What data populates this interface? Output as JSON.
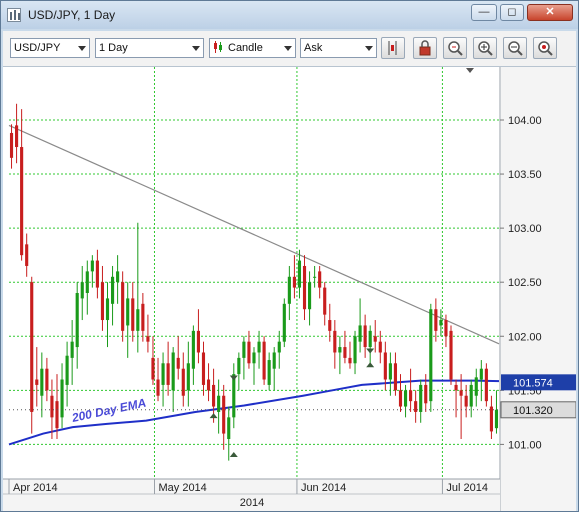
{
  "window": {
    "title": "USD/JPY,  1 Day",
    "minimize": "—",
    "restore": "◻",
    "close": "✕"
  },
  "toolbar": {
    "symbol": "USD/JPY",
    "period": "1 Day",
    "chart_type": "Candle",
    "price_side": "Ask"
  },
  "colors": {
    "up": "#1a9a1a",
    "down": "#c81e1e",
    "grid": "#30c830",
    "ema": "#1f2fc8",
    "trendline": "#8a8a8a",
    "badge": "#1e3fa8"
  },
  "chart_data": {
    "type": "candlestick",
    "symbol": "USD/JPY",
    "timeframe": "1 Day",
    "ylim": [
      100.68,
      104.49
    ],
    "y_ticks": [
      "104.00",
      "103.50",
      "103.00",
      "102.50",
      "102.00",
      "101.50",
      "101.00"
    ],
    "x_ticks": [
      "Apr 2014",
      "May 2014",
      "Jun 2014",
      "Jul 2014"
    ],
    "x_year_label": "2014",
    "current_price": "101.320",
    "ema_value": "101.574",
    "annotation": "200 Day EMA",
    "candles": [
      [
        103.88,
        103.96,
        103.55,
        103.65
      ],
      [
        103.95,
        104.15,
        103.6,
        103.75
      ],
      [
        103.75,
        104.1,
        102.7,
        102.75
      ],
      [
        102.85,
        102.95,
        102.55,
        102.65
      ],
      [
        102.5,
        102.55,
        101.1,
        101.3
      ],
      [
        101.6,
        101.9,
        101.35,
        101.55
      ],
      [
        101.45,
        101.85,
        101.25,
        101.7
      ],
      [
        101.7,
        101.8,
        101.4,
        101.5
      ],
      [
        101.45,
        101.6,
        101.05,
        101.25
      ],
      [
        101.4,
        101.65,
        101.05,
        101.15
      ],
      [
        101.25,
        101.75,
        101.15,
        101.6
      ],
      [
        101.55,
        101.95,
        101.35,
        101.82
      ],
      [
        101.8,
        102.15,
        101.55,
        101.95
      ],
      [
        101.9,
        102.5,
        101.7,
        102.4
      ],
      [
        102.35,
        102.65,
        102.15,
        102.5
      ],
      [
        102.4,
        102.7,
        102.2,
        102.6
      ],
      [
        102.6,
        102.75,
        102.45,
        102.7
      ],
      [
        102.7,
        102.8,
        102.35,
        102.45
      ],
      [
        102.5,
        102.65,
        102.05,
        102.15
      ],
      [
        102.15,
        102.5,
        101.9,
        102.35
      ],
      [
        102.3,
        102.65,
        102.1,
        102.55
      ],
      [
        102.5,
        102.75,
        102.3,
        102.6
      ],
      [
        102.5,
        102.6,
        101.95,
        102.05
      ],
      [
        102.1,
        102.5,
        101.8,
        102.35
      ],
      [
        102.35,
        102.5,
        101.95,
        102.05
      ],
      [
        102.05,
        103.05,
        101.85,
        102.25
      ],
      [
        102.3,
        102.4,
        101.95,
        102.05
      ],
      [
        102.0,
        102.2,
        101.85,
        101.95
      ],
      [
        101.8,
        102.0,
        101.55,
        101.6
      ],
      [
        101.6,
        101.8,
        101.4,
        101.45
      ],
      [
        101.55,
        101.85,
        101.35,
        101.75
      ],
      [
        101.75,
        101.95,
        101.45,
        101.55
      ],
      [
        101.5,
        101.9,
        101.3,
        101.85
      ],
      [
        101.8,
        102.0,
        101.6,
        101.7
      ],
      [
        101.7,
        101.85,
        101.35,
        101.45
      ],
      [
        101.5,
        101.95,
        101.35,
        101.75
      ],
      [
        101.7,
        102.1,
        101.55,
        102.05
      ],
      [
        102.05,
        102.25,
        101.75,
        101.85
      ],
      [
        101.85,
        101.95,
        101.45,
        101.55
      ],
      [
        101.6,
        101.75,
        101.4,
        101.5
      ],
      [
        101.55,
        101.7,
        101.2,
        101.35
      ],
      [
        101.3,
        101.6,
        101.1,
        101.45
      ],
      [
        101.45,
        101.55,
        100.95,
        101.1
      ],
      [
        101.05,
        101.35,
        100.85,
        101.25
      ],
      [
        101.25,
        101.75,
        101.15,
        101.65
      ],
      [
        101.65,
        101.85,
        101.5,
        101.8
      ],
      [
        101.8,
        102.0,
        101.6,
        101.95
      ],
      [
        101.95,
        102.05,
        101.7,
        101.75
      ],
      [
        101.75,
        101.9,
        101.55,
        101.85
      ],
      [
        101.85,
        102.05,
        101.7,
        101.95
      ],
      [
        101.95,
        102.0,
        101.55,
        101.6
      ],
      [
        101.55,
        101.85,
        101.5,
        101.78
      ],
      [
        101.7,
        101.9,
        101.5,
        101.85
      ],
      [
        101.85,
        102.05,
        101.7,
        101.95
      ],
      [
        101.95,
        102.35,
        101.9,
        102.3
      ],
      [
        102.3,
        102.65,
        102.15,
        102.55
      ],
      [
        102.55,
        102.75,
        102.35,
        102.45
      ],
      [
        102.45,
        102.8,
        102.35,
        102.7
      ],
      [
        102.65,
        102.75,
        102.15,
        102.25
      ],
      [
        102.25,
        102.6,
        102.1,
        102.5
      ],
      [
        102.55,
        102.65,
        102.45,
        102.55
      ],
      [
        102.6,
        102.65,
        102.35,
        102.45
      ],
      [
        102.45,
        102.5,
        102.1,
        102.2
      ],
      [
        102.15,
        102.3,
        101.95,
        102.05
      ],
      [
        102.05,
        102.15,
        101.7,
        101.85
      ],
      [
        101.85,
        102.0,
        101.65,
        101.9
      ],
      [
        101.9,
        102.05,
        101.75,
        101.8
      ],
      [
        101.8,
        101.95,
        101.7,
        101.75
      ],
      [
        101.75,
        102.05,
        101.65,
        102.0
      ],
      [
        101.95,
        102.35,
        101.85,
        102.1
      ],
      [
        102.1,
        102.2,
        101.8,
        101.9
      ],
      [
        101.9,
        102.1,
        101.75,
        102.05
      ],
      [
        102.0,
        102.15,
        101.85,
        101.95
      ],
      [
        101.95,
        102.05,
        101.75,
        101.85
      ],
      [
        101.85,
        101.95,
        101.5,
        101.6
      ],
      [
        101.6,
        101.85,
        101.45,
        101.75
      ],
      [
        101.75,
        101.85,
        101.45,
        101.5
      ],
      [
        101.5,
        101.65,
        101.3,
        101.35
      ],
      [
        101.35,
        101.55,
        101.25,
        101.5
      ],
      [
        101.5,
        101.7,
        101.3,
        101.4
      ],
      [
        101.4,
        101.5,
        101.2,
        101.3
      ],
      [
        101.3,
        101.6,
        101.2,
        101.55
      ],
      [
        101.55,
        101.65,
        101.3,
        101.38
      ],
      [
        101.4,
        102.3,
        101.3,
        102.25
      ],
      [
        102.25,
        102.35,
        101.95,
        102.05
      ],
      [
        102.1,
        102.25,
        102.0,
        102.15
      ],
      [
        102.15,
        102.2,
        101.9,
        102.0
      ],
      [
        102.05,
        102.1,
        101.55,
        101.6
      ],
      [
        101.55,
        101.6,
        101.25,
        101.5
      ],
      [
        101.5,
        101.65,
        101.05,
        101.45
      ],
      [
        101.45,
        101.55,
        101.25,
        101.35
      ],
      [
        101.35,
        101.6,
        101.25,
        101.55
      ],
      [
        101.45,
        101.7,
        101.35,
        101.62
      ],
      [
        101.6,
        101.78,
        101.4,
        101.7
      ],
      [
        101.7,
        101.75,
        101.35,
        101.4
      ],
      [
        101.35,
        101.45,
        101.05,
        101.12
      ],
      [
        101.15,
        101.5,
        101.1,
        101.32
      ]
    ],
    "ema": [
      [
        0,
        101.0
      ],
      [
        0.07,
        101.1
      ],
      [
        0.13,
        101.16
      ],
      [
        0.2,
        101.19
      ],
      [
        0.28,
        101.22
      ],
      [
        0.38,
        101.3
      ],
      [
        0.48,
        101.36
      ],
      [
        0.6,
        101.45
      ],
      [
        0.66,
        101.5
      ],
      [
        0.72,
        101.55
      ],
      [
        0.78,
        101.57
      ],
      [
        0.84,
        101.59
      ],
      [
        0.9,
        101.59
      ],
      [
        0.95,
        101.59
      ],
      [
        1,
        101.585
      ]
    ],
    "trendline": {
      "start": [
        0,
        103.95
      ],
      "end": [
        1,
        101.93
      ]
    },
    "markers": [
      {
        "type": "up",
        "index": 44,
        "price": 100.92
      },
      {
        "type": "down",
        "index": 44,
        "price": 101.6
      },
      {
        "type": "up",
        "index": 40,
        "price": 101.28
      },
      {
        "type": "down",
        "index": 71,
        "price": 101.85
      },
      {
        "type": "up",
        "index": 71,
        "price": 101.75
      }
    ]
  }
}
